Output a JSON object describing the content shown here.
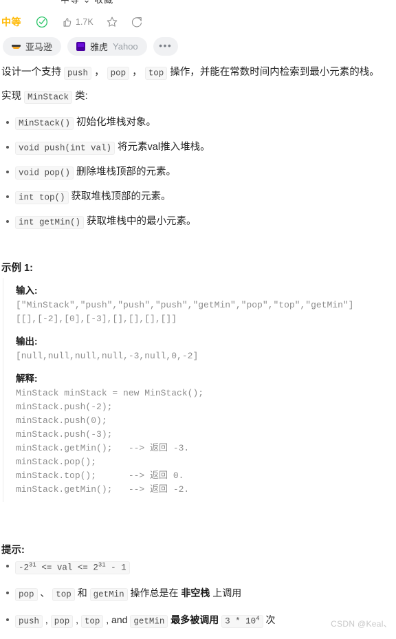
{
  "clipped_top_text": "中等 ⌄ 收藏",
  "meta": {
    "difficulty": "中等",
    "solved_icon": "check-circle-icon",
    "like_icon": "thumbs-up-icon",
    "like_count": "1.7K",
    "favorite_icon": "star-icon",
    "share_icon": "share-icon",
    "accent_color": "#ffb800",
    "solved_color": "#2ec56a"
  },
  "tags": [
    {
      "label": "亚马逊",
      "sub": "",
      "logo": "amazon-logo"
    },
    {
      "label": "雅虎",
      "sub": "Yahoo",
      "logo": "yahoo-logo"
    }
  ],
  "more_tags_label": "•••",
  "description": {
    "line1_a": "设计一个支持 ",
    "code_push": "push",
    "sep1": " ， ",
    "code_pop": "pop",
    "sep2": " ， ",
    "code_top": "top",
    "line1_b": " 操作，并能在常数时间内检索到最小元素的栈。",
    "line2_a": "实现 ",
    "code_minstack": "MinStack",
    "line2_b": " 类:"
  },
  "api_list": [
    {
      "code": "MinStack()",
      "text": " 初始化堆栈对象。"
    },
    {
      "code": "void push(int val)",
      "text": " 将元素val推入堆栈。"
    },
    {
      "code": "void pop()",
      "text": " 删除堆栈顶部的元素。"
    },
    {
      "code": "int top()",
      "text": " 获取堆栈顶部的元素。"
    },
    {
      "code": "int getMin()",
      "text": " 获取堆栈中的最小元素。"
    }
  ],
  "example": {
    "title": "示例 1:",
    "input_label": "输入:",
    "input_lines": "[\"MinStack\",\"push\",\"push\",\"push\",\"getMin\",\"pop\",\"top\",\"getMin\"]\n[[],[-2],[0],[-3],[],[],[],[]]",
    "output_label": "输出:",
    "output_lines": "[null,null,null,null,-3,null,0,-2]",
    "explain_label": "解释:",
    "explain_lines": "MinStack minStack = new MinStack();\nminStack.push(-2);\nminStack.push(0);\nminStack.push(-3);\nminStack.getMin();   --> 返回 -3.\nminStack.pop();\nminStack.top();      --> 返回 0.\nminStack.getMin();   --> 返回 -2."
  },
  "hints": {
    "title": "提示:",
    "item1": {
      "code_prefix": "-2",
      "sup1": "31",
      "mid": " <= val <= 2",
      "sup2": "31",
      "suffix": " - 1"
    },
    "item2": {
      "code_pop": "pop",
      "t1": " 、 ",
      "code_top": "top",
      "t2": " 和 ",
      "code_getmin": "getMin",
      "t3": " 操作总是在 ",
      "strong": "非空栈",
      "t4": " 上调用"
    },
    "item3": {
      "code_push": "push",
      "t1": " , ",
      "code_pop": "pop",
      "t2": " , ",
      "code_top": "top",
      "t3": " , and ",
      "code_getmin": "getMin",
      "t4": " 最多被调用 ",
      "code_num_a": "3 * 10",
      "sup": "4",
      "t5": " 次"
    }
  },
  "watermark": "CSDN @Keal、"
}
